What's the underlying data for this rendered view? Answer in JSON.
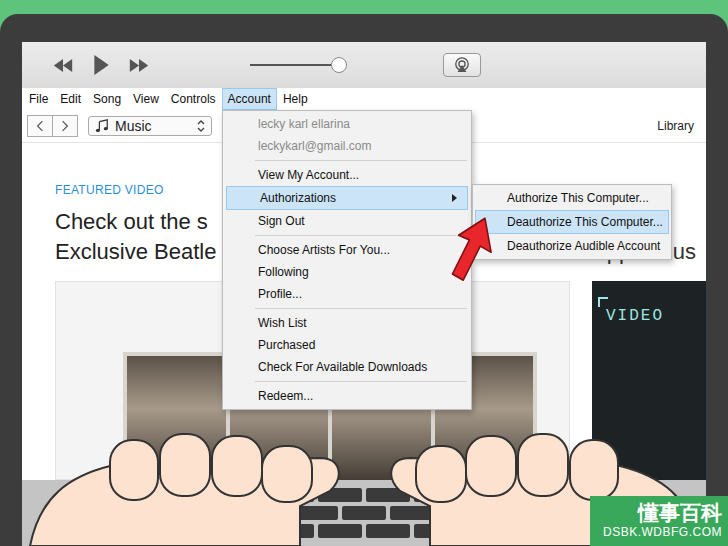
{
  "player": {
    "volume": 0.93
  },
  "menubar": [
    {
      "label": "File",
      "selected": false
    },
    {
      "label": "Edit",
      "selected": false
    },
    {
      "label": "Song",
      "selected": false
    },
    {
      "label": "View",
      "selected": false
    },
    {
      "label": "Controls",
      "selected": false
    },
    {
      "label": "Account",
      "selected": true
    },
    {
      "label": "Help",
      "selected": false
    }
  ],
  "nav": {
    "source": "Music",
    "right_link": "Library"
  },
  "content": {
    "featured_label": "FEATURED VIDEO",
    "headline": [
      "Check out the s",
      "Exclusive Beatle"
    ],
    "side_heading": "Apple Mus",
    "video_label": "VIDEO"
  },
  "account_menu": {
    "groups": [
      [
        {
          "label": "lecky karl ellarina",
          "disabled": true,
          "selected": false,
          "has_submenu": false
        },
        {
          "label": "leckykarl@gmail.com",
          "disabled": true,
          "selected": false,
          "has_submenu": false
        }
      ],
      [
        {
          "label": "View My Account...",
          "disabled": false,
          "selected": false,
          "has_submenu": false
        },
        {
          "label": "Authorizations",
          "disabled": false,
          "selected": true,
          "has_submenu": true
        },
        {
          "label": "Sign Out",
          "disabled": false,
          "selected": false,
          "has_submenu": false
        }
      ],
      [
        {
          "label": "Choose Artists For You...",
          "disabled": false,
          "selected": false,
          "has_submenu": false
        },
        {
          "label": "Following",
          "disabled": false,
          "selected": false,
          "has_submenu": false
        },
        {
          "label": "Profile...",
          "disabled": false,
          "selected": false,
          "has_submenu": false
        }
      ],
      [
        {
          "label": "Wish List",
          "disabled": false,
          "selected": false,
          "has_submenu": false
        },
        {
          "label": "Purchased",
          "disabled": false,
          "selected": false,
          "has_submenu": false
        },
        {
          "label": "Check For Available Downloads",
          "disabled": false,
          "selected": false,
          "has_submenu": false
        }
      ],
      [
        {
          "label": "Redeem...",
          "disabled": false,
          "selected": false,
          "has_submenu": false
        }
      ]
    ]
  },
  "submenu": [
    {
      "label": "Authorize This Computer...",
      "selected": false
    },
    {
      "label": "Deauthorize This Computer...",
      "selected": true
    },
    {
      "label": "Deauthorize Audible Account",
      "selected": false
    }
  ],
  "watermark": {
    "title": "懂事百科",
    "url": "DSBK.WDBFG.COM"
  }
}
